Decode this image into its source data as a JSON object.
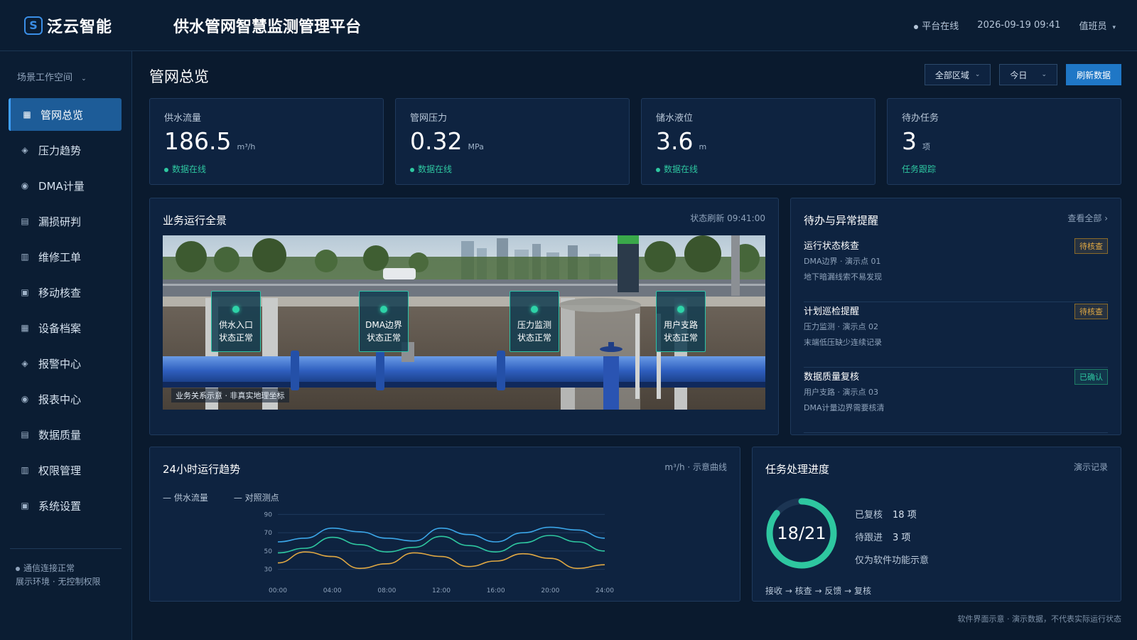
{
  "brand": {
    "logo_text": "泛云智能",
    "platform_title": "供水管网智慧监测管理平台"
  },
  "header": {
    "status": "平台在线",
    "datetime": "2026-09-19 09:41",
    "user": "值班员"
  },
  "sidebar": {
    "workspace": "场景工作空间",
    "items": [
      {
        "label": "管网总览",
        "icon": "grid-icon",
        "active": true
      },
      {
        "label": "压力趋势",
        "icon": "diamond-icon"
      },
      {
        "label": "DMA计量",
        "icon": "circle-icon"
      },
      {
        "label": "漏损研判",
        "icon": "list-icon"
      },
      {
        "label": "维修工单",
        "icon": "table-icon"
      },
      {
        "label": "移动核查",
        "icon": "square-icon"
      },
      {
        "label": "设备档案",
        "icon": "grid-icon"
      },
      {
        "label": "报警中心",
        "icon": "diamond-icon"
      },
      {
        "label": "报表中心",
        "icon": "circle-icon"
      },
      {
        "label": "数据质量",
        "icon": "list-icon"
      },
      {
        "label": "权限管理",
        "icon": "table-icon"
      },
      {
        "label": "系统设置",
        "icon": "square-icon"
      }
    ],
    "footer_status": "通信连接正常",
    "footer_note": "展示环境 · 无控制权限"
  },
  "main": {
    "title": "管网总览",
    "toolbar": {
      "region": "全部区域",
      "period": "今日",
      "refresh": "刷新数据"
    }
  },
  "kpis": [
    {
      "title": "供水流量",
      "value": "186.5",
      "unit": "m³/h",
      "status": "数据在线"
    },
    {
      "title": "管网压力",
      "value": "0.32",
      "unit": "MPa",
      "status": "数据在线"
    },
    {
      "title": "储水液位",
      "value": "3.6",
      "unit": "m",
      "status": "数据在线"
    },
    {
      "title": "待办任务",
      "value": "3",
      "unit": "项",
      "status": "任务跟踪"
    }
  ],
  "overview": {
    "title": "业务运行全景",
    "refresh_time": "状态刷新 09:41:00",
    "hotspots": [
      {
        "name": "供水入口",
        "state": "状态正常"
      },
      {
        "name": "DMA边界",
        "state": "状态正常"
      },
      {
        "name": "压力监测",
        "state": "状态正常"
      },
      {
        "name": "用户支路",
        "state": "状态正常"
      }
    ],
    "note": "业务关系示意 · 非真实地理坐标"
  },
  "alerts": {
    "title": "待办与异常提醒",
    "view_all": "查看全部 ›",
    "items": [
      {
        "title": "运行状态核查",
        "sub": "DMA边界 · 演示点 01",
        "desc": "地下暗漏线索不易发现",
        "badge": "待核查",
        "state": "pending"
      },
      {
        "title": "计划巡检提醒",
        "sub": "压力监测 · 演示点 02",
        "desc": "末端低压缺少连续记录",
        "badge": "待核查",
        "state": "pending"
      },
      {
        "title": "数据质量复核",
        "sub": "用户支路 · 演示点 03",
        "desc": "DMA计量边界需要核清",
        "badge": "已确认",
        "state": "done"
      }
    ]
  },
  "trend": {
    "title": "24小时运行趋势",
    "meta": "m³/h · 示意曲线",
    "legend": [
      "— 供水流量",
      "— 对照测点"
    ]
  },
  "chart_data": {
    "type": "line",
    "x": [
      "00:00",
      "02:00",
      "04:00",
      "06:00",
      "08:00",
      "10:00",
      "12:00",
      "14:00",
      "16:00",
      "18:00",
      "20:00",
      "22:00",
      "24:00"
    ],
    "x_tick_labels": [
      "00:00",
      "04:00",
      "08:00",
      "12:00",
      "16:00",
      "20:00",
      "24:00"
    ],
    "y_ticks": [
      30,
      50,
      70,
      90
    ],
    "ylim": [
      25,
      95
    ],
    "grid": true,
    "series": [
      {
        "name": "供水流量",
        "color": "#3ba6e8",
        "values": [
          60,
          64,
          75,
          71,
          64,
          61,
          75,
          68,
          60,
          70,
          76,
          73,
          64
        ]
      },
      {
        "name": "对照测点",
        "color": "#2ec7a0",
        "values": [
          48,
          53,
          65,
          57,
          49,
          54,
          66,
          56,
          49,
          59,
          67,
          60,
          50
        ]
      },
      {
        "values": [
          37,
          49,
          44,
          31,
          36,
          48,
          44,
          33,
          39,
          47,
          42,
          31,
          35
        ],
        "color": "#e0a843"
      }
    ]
  },
  "progress": {
    "title": "任务处理进度",
    "meta": "演示记录",
    "done": 18,
    "total": 21,
    "ratio_text": "18/21",
    "reviewed_label": "已复核",
    "reviewed_value": "18 项",
    "pending_label": "待跟进",
    "pending_value": "3 项",
    "note": "仅为软件功能示意",
    "flow": "接收 → 核查 → 反馈 → 复核"
  },
  "footer": {
    "note": "软件界面示意 · 演示数据，不代表实际运行状态"
  },
  "colors": {
    "accent": "#1f77c6",
    "online": "#2ec7a0",
    "pending": "#e0a843",
    "bg": "#0a1a2e"
  }
}
